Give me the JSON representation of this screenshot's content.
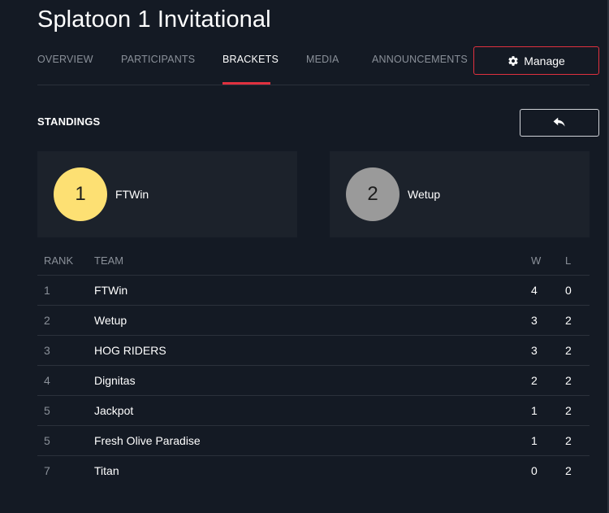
{
  "header": {
    "title": "Splatoon 1 Invitational"
  },
  "nav": {
    "tabs": [
      {
        "label": "OVERVIEW"
      },
      {
        "label": "PARTICIPANTS"
      },
      {
        "label": "BRACKETS"
      },
      {
        "label": "MEDIA"
      },
      {
        "label": "ANNOUNCEMENTS"
      }
    ],
    "active_tab": "BRACKETS",
    "manage_label": "Manage",
    "manage_icon": "gear-icon"
  },
  "standings": {
    "title": "STANDINGS",
    "back_icon": "reply-arrow-icon",
    "podium": [
      {
        "rank": "1",
        "team": "FTWin",
        "color": "#fde073"
      },
      {
        "rank": "2",
        "team": "Wetup",
        "color": "#9a9a9a"
      }
    ],
    "table": {
      "headers": {
        "rank": "RANK",
        "team": "TEAM",
        "w": "W",
        "l": "L"
      },
      "rows": [
        {
          "rank": "1",
          "team": "FTWin",
          "w": "4",
          "l": "0"
        },
        {
          "rank": "2",
          "team": "Wetup",
          "w": "3",
          "l": "2"
        },
        {
          "rank": "3",
          "team": "HOG RIDERS",
          "w": "3",
          "l": "2"
        },
        {
          "rank": "4",
          "team": "Dignitas",
          "w": "2",
          "l": "2"
        },
        {
          "rank": "5",
          "team": "Jackpot",
          "w": "1",
          "l": "2"
        },
        {
          "rank": "5",
          "team": "Fresh Olive Paradise",
          "w": "1",
          "l": "2"
        },
        {
          "rank": "7",
          "team": "Titan",
          "w": "0",
          "l": "2"
        }
      ]
    }
  },
  "colors": {
    "background": "#141a24",
    "card": "#1c222b",
    "accent": "#e0313f",
    "muted": "#8a9099"
  }
}
